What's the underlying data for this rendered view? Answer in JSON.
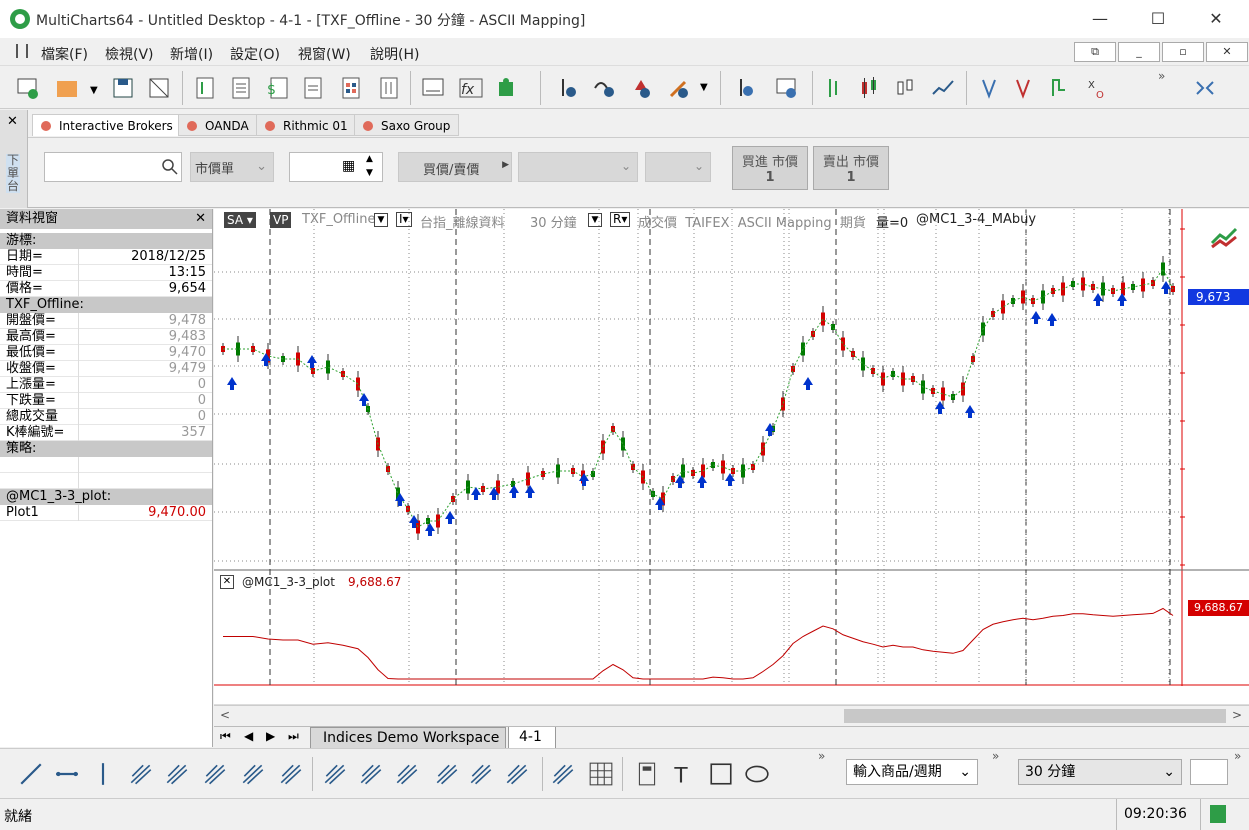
{
  "window": {
    "title": "MultiCharts64 - Untitled Desktop - 4-1 - [TXF_Offline - 30 分鐘 - ASCII Mapping]",
    "minimize": "—",
    "maximize": "☐",
    "close": "✕"
  },
  "menu": [
    "檔案(F)",
    "檢視(V)",
    "新增(I)",
    "設定(O)",
    "視窗(W)",
    "說明(H)"
  ],
  "broker": {
    "tabs": [
      "Interactive Brokers",
      "OANDA",
      "Rithmic 01",
      "Saxo Group"
    ],
    "order_type": "市價單",
    "buy_sell": "買價/賣價",
    "buy_market": "買進 市價",
    "buy_qty": "1",
    "sell_market": "賣出 市價",
    "sell_qty": "1",
    "side_label": "下單台"
  },
  "dataview": {
    "title": "資料視窗",
    "cursor_section": "游標:",
    "cursor_rows": [
      {
        "k": "日期=",
        "v": "2018/12/25"
      },
      {
        "k": "時間=",
        "v": "13:15"
      },
      {
        "k": "價格=",
        "v": "9,654"
      }
    ],
    "symbol_section": "TXF_Offline:",
    "symbol_rows": [
      {
        "k": "開盤價=",
        "v": "9,478"
      },
      {
        "k": "最高價=",
        "v": "9,483"
      },
      {
        "k": "最低價=",
        "v": "9,470"
      },
      {
        "k": "收盤價=",
        "v": "9,479"
      },
      {
        "k": "上漲量=",
        "v": "0"
      },
      {
        "k": "下跌量=",
        "v": "0"
      },
      {
        "k": "總成交量",
        "v": "0"
      },
      {
        "k": "K棒編號=",
        "v": "357"
      }
    ],
    "strategy_section": "策略:",
    "plot_section": "@MC1_3-3_plot:",
    "plot_row": {
      "k": "Plot1",
      "v": "9,470.00"
    }
  },
  "chart": {
    "header_sa": "SA",
    "header_vp": "VP",
    "header_symbol": "TXF_Offline",
    "header_i": "I",
    "header_desc": "台指_離線資料",
    "header_interval": "30 分鐘",
    "header_r": "R",
    "header_rest": "成交價  TAIFEX  ASCII Mapping  期貨",
    "header_vol": "量=0",
    "header_strategy": "@MC1_3-4_MAbuy",
    "price_label": "9,673",
    "sub_title": "@MC1_3-3_plot",
    "sub_value": "9,688.67",
    "sub_price_label": "9,688.67",
    "up_color": "#d40000",
    "down_color": "#007a00",
    "arrow_color": "#0033cc"
  },
  "workspace_tabs": [
    "Indices Demo Workspace",
    "4-1"
  ],
  "drawbar": {
    "symbol_input": "輸入商品/週期",
    "interval": "30 分鐘"
  },
  "status": {
    "text": "就緒",
    "time": "09:20:36"
  }
}
